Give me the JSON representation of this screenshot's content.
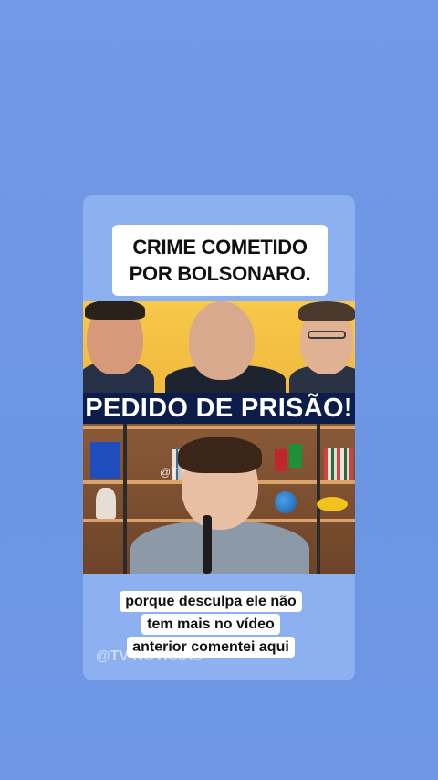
{
  "headline": {
    "line1": "CRIME COMETIDO",
    "line2": "POR BOLSONARO."
  },
  "video": {
    "banner_text": "PEDIDO DE PRISÃO!",
    "watermark_inset": "@T"
  },
  "caption": {
    "line1": "porque desculpa ele não",
    "line2": "tem mais no vídeo",
    "line3": "anterior comentei aqui"
  },
  "channel_tag": "@TV NOTICIAS",
  "colors": {
    "background": "#6f98e6",
    "card": "#8db0f0",
    "banner": "#0d1d4a",
    "thumb_top": "#f3bf42"
  }
}
